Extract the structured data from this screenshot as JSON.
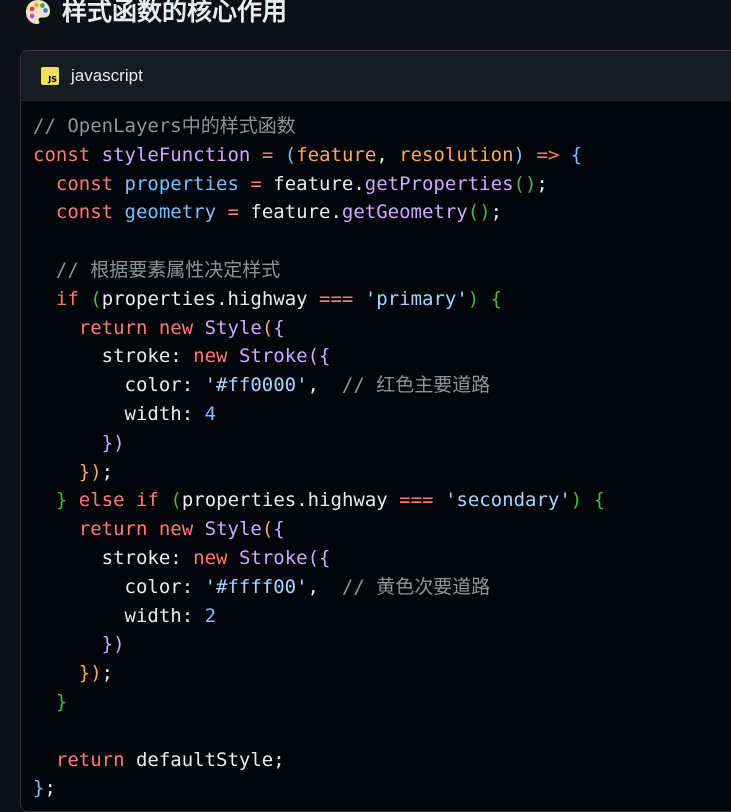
{
  "page": {
    "heading_title": "样式函数的核心作用",
    "heading_icon": "palette-icon"
  },
  "code_block": {
    "language_label": "javascript",
    "language_badge": "JS",
    "lines": [
      "// OpenLayers中的样式函数",
      "const styleFunction = (feature, resolution) => {",
      "  const properties = feature.getProperties();",
      "  const geometry = feature.getGeometry();",
      "",
      "  // 根据要素属性决定样式",
      "  if (properties.highway === 'primary') {",
      "    return new Style({",
      "      stroke: new Stroke({",
      "        color: '#ff0000',  // 红色主要道路",
      "        width: 4",
      "      })",
      "    });",
      "  } else if (properties.highway === 'secondary') {",
      "    return new Style({",
      "      stroke: new Stroke({",
      "        color: '#ffff00',  // 黄色次要道路",
      "        width: 2",
      "      })",
      "    });",
      "  }",
      "",
      "  return defaultStyle;",
      "};"
    ]
  },
  "colors": {
    "background": "#0d1117",
    "keyword": "#ff7b72",
    "function": "#d2a8ff",
    "variable": "#79c0ff",
    "string": "#a5d6ff",
    "comment": "#8b949e",
    "parameter": "#ffa657",
    "bracket_green": "#3fb950"
  }
}
